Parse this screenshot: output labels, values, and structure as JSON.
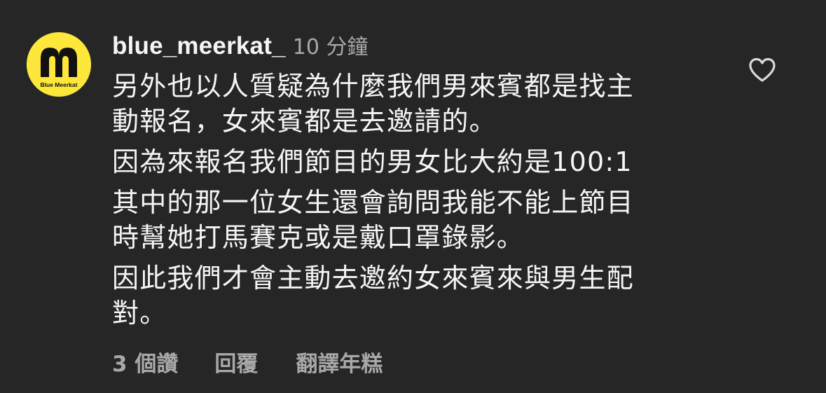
{
  "comment": {
    "avatar": {
      "logo_text": "Blue Meerkat",
      "background_color": "#fde73a"
    },
    "username": "blue_meerkat_",
    "timestamp": "10 分鐘",
    "lines": [
      "另外也以人質疑為什麼我們男來賓都是找主",
      "動報名，女來賓都是去邀請的。",
      "因為來報名我們節目的男女比大約是100:1",
      "其中的那一位女生還會詢問我能不能上節目",
      "時幫她打馬賽克或是戴口罩錄影。",
      "因此我們才會主動去邀約女來賓來與男生配",
      "對。"
    ],
    "like_icon": "heart-outline-icon",
    "actions": {
      "likes": "3 個讚",
      "reply": "回覆",
      "translate": "翻譯年糕"
    }
  }
}
